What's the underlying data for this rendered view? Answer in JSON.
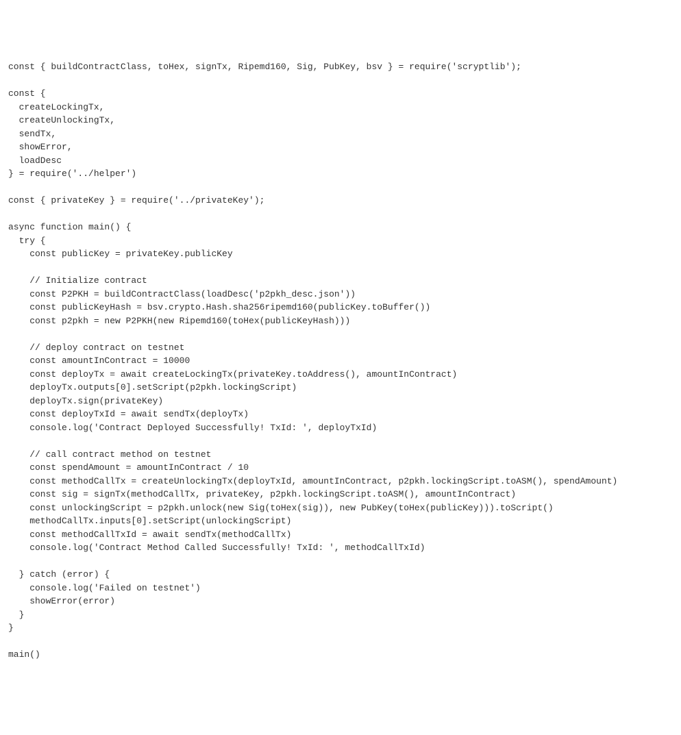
{
  "code": {
    "lines": [
      "const { buildContractClass, toHex, signTx, Ripemd160, Sig, PubKey, bsv } = require('scryptlib');",
      "",
      "const {",
      "  createLockingTx,",
      "  createUnlockingTx,",
      "  sendTx,",
      "  showError,",
      "  loadDesc",
      "} = require('../helper')",
      "",
      "const { privateKey } = require('../privateKey');",
      "",
      "async function main() {",
      "  try {",
      "    const publicKey = privateKey.publicKey",
      "",
      "    // Initialize contract",
      "    const P2PKH = buildContractClass(loadDesc('p2pkh_desc.json'))",
      "    const publicKeyHash = bsv.crypto.Hash.sha256ripemd160(publicKey.toBuffer())",
      "    const p2pkh = new P2PKH(new Ripemd160(toHex(publicKeyHash)))",
      "",
      "    // deploy contract on testnet",
      "    const amountInContract = 10000",
      "    const deployTx = await createLockingTx(privateKey.toAddress(), amountInContract)",
      "    deployTx.outputs[0].setScript(p2pkh.lockingScript)",
      "    deployTx.sign(privateKey)",
      "    const deployTxId = await sendTx(deployTx)",
      "    console.log('Contract Deployed Successfully! TxId: ', deployTxId)",
      "",
      "    // call contract method on testnet",
      "    const spendAmount = amountInContract / 10",
      "    const methodCallTx = createUnlockingTx(deployTxId, amountInContract, p2pkh.lockingScript.toASM(), spendAmount)",
      "    const sig = signTx(methodCallTx, privateKey, p2pkh.lockingScript.toASM(), amountInContract)",
      "    const unlockingScript = p2pkh.unlock(new Sig(toHex(sig)), new PubKey(toHex(publicKey))).toScript()",
      "    methodCallTx.inputs[0].setScript(unlockingScript)",
      "    const methodCallTxId = await sendTx(methodCallTx)",
      "    console.log('Contract Method Called Successfully! TxId: ', methodCallTxId)",
      "",
      "  } catch (error) {",
      "    console.log('Failed on testnet')",
      "    showError(error)",
      "  }",
      "}",
      "",
      "main()"
    ]
  }
}
